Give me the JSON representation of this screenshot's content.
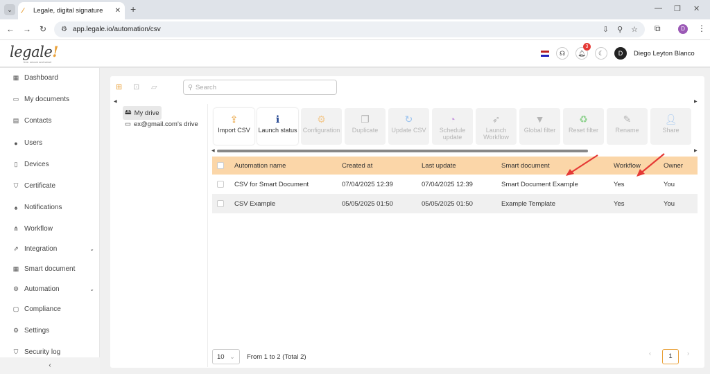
{
  "browser": {
    "tab_title": "Legale, digital signature",
    "url": "app.legale.io/automation/csv",
    "profile_initial": "D"
  },
  "header": {
    "logo_text": "legale",
    "logo_mark": "!",
    "logo_tagline": "free. secure and smart",
    "notification_count": "3",
    "user_initial": "D",
    "user_name": "Diego Leyton Blanco"
  },
  "sidebar": {
    "items": [
      {
        "label": "Dashboard",
        "icon": "dashboard-icon"
      },
      {
        "label": "My documents",
        "icon": "folder-icon"
      },
      {
        "label": "Contacts",
        "icon": "contacts-icon"
      },
      {
        "label": "Users",
        "icon": "user-icon"
      },
      {
        "label": "Devices",
        "icon": "device-icon"
      },
      {
        "label": "Certificate",
        "icon": "shield-icon"
      },
      {
        "label": "Notifications",
        "icon": "bell-icon"
      },
      {
        "label": "Workflow",
        "icon": "workflow-icon"
      },
      {
        "label": "Integration",
        "icon": "integration-icon"
      },
      {
        "label": "Smart document",
        "icon": "smart-doc-icon"
      },
      {
        "label": "Automation",
        "icon": "gear-icon"
      },
      {
        "label": "Compliance",
        "icon": "chat-icon"
      },
      {
        "label": "Settings",
        "icon": "settings-icon"
      },
      {
        "label": "Security log",
        "icon": "lock-icon"
      }
    ],
    "collapse_glyph": "‹"
  },
  "search": {
    "placeholder": "Search"
  },
  "tree": {
    "root": "My drive",
    "child": "ex@gmail.com's drive"
  },
  "actions": [
    {
      "label": "Import CSV",
      "enabled": true
    },
    {
      "label": "Launch status",
      "enabled": true
    },
    {
      "label": "Configuration",
      "enabled": false
    },
    {
      "label": "Duplicate",
      "enabled": false
    },
    {
      "label": "Update CSV",
      "enabled": false
    },
    {
      "label": "Schedule update",
      "enabled": false
    },
    {
      "label": "Launch Workflow",
      "enabled": false
    },
    {
      "label": "Global filter",
      "enabled": false
    },
    {
      "label": "Reset filter",
      "enabled": false
    },
    {
      "label": "Rename",
      "enabled": false
    },
    {
      "label": "Share",
      "enabled": false
    }
  ],
  "table": {
    "headers": [
      "Automation name",
      "Created at",
      "Last update",
      "Smart document",
      "Workflow",
      "Owner"
    ],
    "rows": [
      [
        "CSV for Smart Document",
        "07/04/2025 12:39",
        "07/04/2025 12:39",
        "Smart Document Example",
        "Yes",
        "You"
      ],
      [
        "CSV Example",
        "05/05/2025 01:50",
        "05/05/2025 01:50",
        "Example Template",
        "Yes",
        "You"
      ]
    ]
  },
  "pagination": {
    "page_size": "10",
    "summary": "From 1 to 2 (Total 2)",
    "current_page": "1"
  },
  "colors": {
    "accent": "#e9a13a",
    "header_row": "#fbd6a8",
    "annotation_arrow": "#e53935"
  }
}
